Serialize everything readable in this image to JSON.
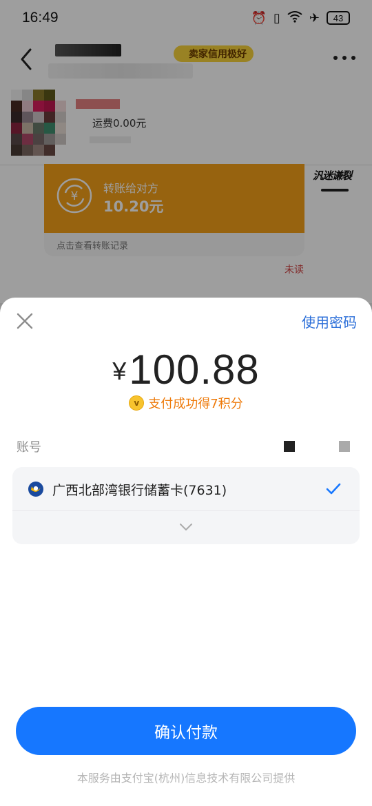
{
  "status_bar": {
    "time": "16:49",
    "battery": "43"
  },
  "chat": {
    "credit_badge": "卖家信用极好",
    "shipping_fee": "运费0.00元",
    "transfer": {
      "label": "转账给对方",
      "amount": "10.20元",
      "footer": "点击查看转账记录"
    },
    "sticker_text": "汎迷谦裂",
    "unread": "未读"
  },
  "payment_sheet": {
    "use_password": "使用密码",
    "currency": "¥",
    "amount": "100.88",
    "points_text": "支付成功得7积分",
    "coin_symbol": "v",
    "account_label": "账号",
    "bank_card": "广西北部湾银行储蓄卡(7631)",
    "confirm_button": "确认付款",
    "footer_note": "本服务由支付宝(杭州)信息技术有限公司提供"
  },
  "colors": {
    "accent_blue": "#1677ff",
    "link_blue": "#2c6fd9",
    "points_orange": "#ee7a0a",
    "transfer_orange": "#f4a019"
  }
}
